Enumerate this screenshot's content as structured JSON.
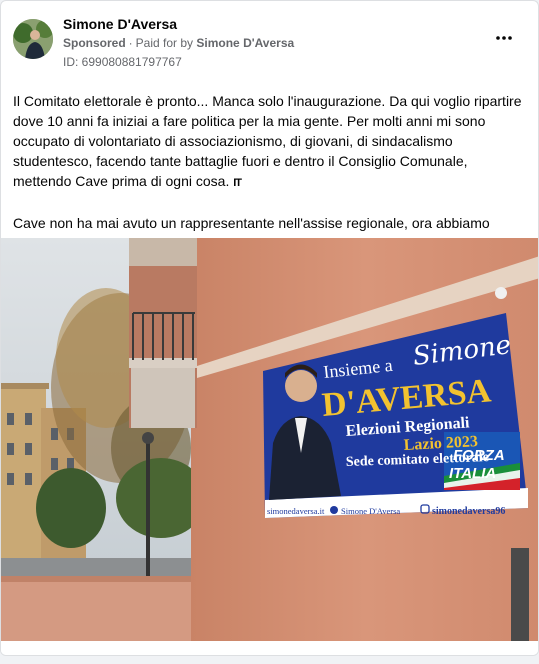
{
  "post": {
    "author": "Simone D'Aversa",
    "sponsored": "Sponsored",
    "paid_prefix": "Paid for by",
    "paid_by": "Simone D'Aversa",
    "ad_id": "ID: 699080881797767",
    "more_icon": "more-horizontal-icon",
    "text": {
      "line1": "Il Comitato elettorale è pronto... Manca solo l'inaugurazione. Da qui voglio ripartire dove 10 anni fa iniziai a fare politica per la mia gente. Per molti anni mi sono occupato di volontariato di associazionismo, di giovani, di sindacalismo studentesco, facendo tante battaglie fuori e dentro il Consiglio Comunale, mettendo Cave prima di ogni cosa.",
      "flag": "IT",
      "line2": "Cave non ha mai avuto un rappresentante nell'assise regionale, ora abbiamo una..."
    }
  },
  "banner": {
    "line1a": "Insieme a",
    "line1b": "Simone",
    "name": "D'AVERSA",
    "subtitle": "Elezioni Regionali",
    "region": "Lazio 2023",
    "office": "Sede comitato elettorale",
    "party1": "FORZA",
    "party2": "ITALIA",
    "site": "simonedaversa.it",
    "facebook": "Simone D'Aversa",
    "instagram": "simonedaversa96"
  },
  "colors": {
    "banner_blue": "#1f3a9e",
    "banner_yellow": "#f2c230",
    "wall": "#d9967a",
    "sky": "#c9d1d8"
  }
}
